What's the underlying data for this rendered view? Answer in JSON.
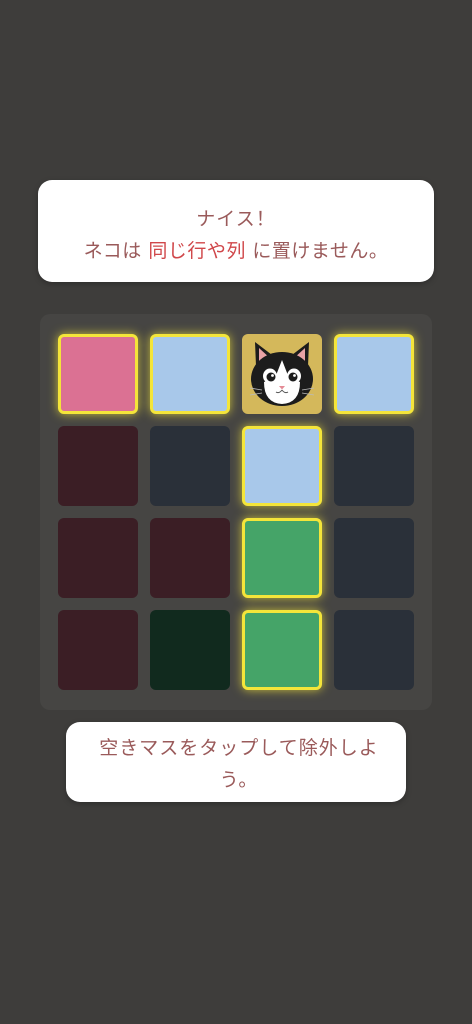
{
  "hint": {
    "line1": "ナイス！",
    "line2_prefix": "ネコは ",
    "line2_emphasis": "同じ行や列",
    "line2_suffix": " に置けません。"
  },
  "board": {
    "rows": 4,
    "cols": 4,
    "cells": [
      [
        {
          "color": "#db7193",
          "highlighted": true,
          "content": "empty"
        },
        {
          "color": "#a8c8ea",
          "highlighted": true,
          "content": "empty"
        },
        {
          "color": "#d4b85b",
          "highlighted": false,
          "content": "cat"
        },
        {
          "color": "#a8c8ea",
          "highlighted": true,
          "content": "empty"
        }
      ],
      [
        {
          "color": "#3b1e25",
          "highlighted": false,
          "content": "empty"
        },
        {
          "color": "#2a3039",
          "highlighted": false,
          "content": "empty"
        },
        {
          "color": "#a8c8ea",
          "highlighted": true,
          "content": "empty"
        },
        {
          "color": "#2a3039",
          "highlighted": false,
          "content": "empty"
        }
      ],
      [
        {
          "color": "#3b1e25",
          "highlighted": false,
          "content": "empty"
        },
        {
          "color": "#3b1e25",
          "highlighted": false,
          "content": "empty"
        },
        {
          "color": "#45a468",
          "highlighted": true,
          "content": "empty"
        },
        {
          "color": "#2a3039",
          "highlighted": false,
          "content": "empty"
        }
      ],
      [
        {
          "color": "#3b1e25",
          "highlighted": false,
          "content": "empty"
        },
        {
          "color": "#112a1e",
          "highlighted": false,
          "content": "empty"
        },
        {
          "color": "#45a468",
          "highlighted": true,
          "content": "empty"
        },
        {
          "color": "#2a3039",
          "highlighted": false,
          "content": "empty"
        }
      ]
    ]
  },
  "instruction": {
    "text": "空きマスをタップして除外しよう。"
  },
  "colors": {
    "background": "#3e3d3b",
    "board": "#464543",
    "highlight": "#f4e53a",
    "text": "#9a5a5a",
    "emphasis": "#d0474a"
  },
  "icons": {
    "cat": "cat-face-icon"
  }
}
